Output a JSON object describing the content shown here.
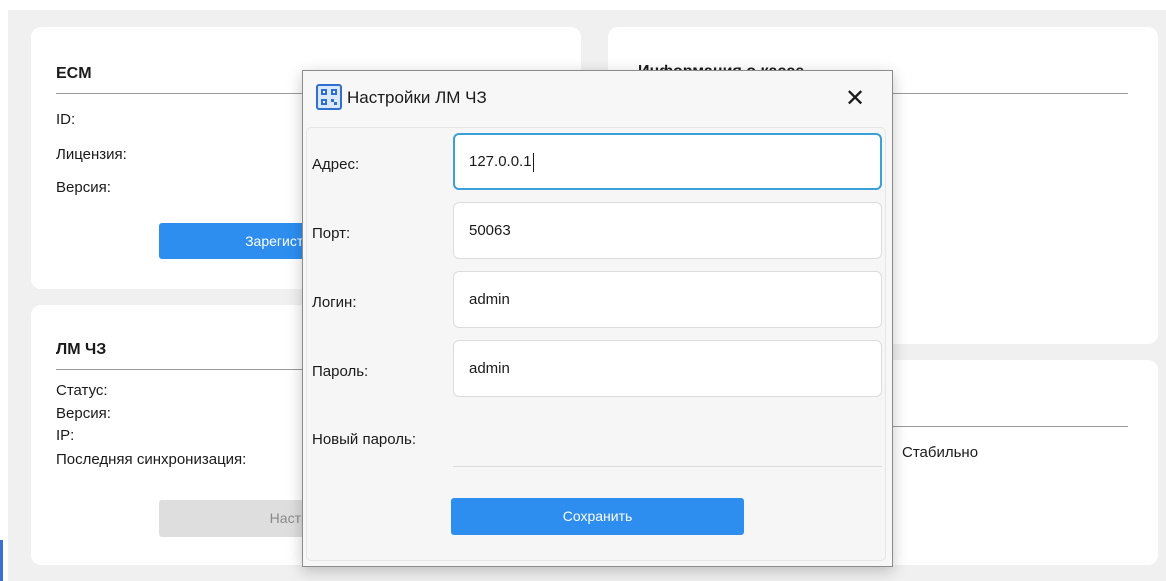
{
  "ecm_card": {
    "title": "ECM",
    "fields": [
      "ID:",
      "Лицензия:",
      "Версия:"
    ],
    "register_button": "Зарегистрировать"
  },
  "lm_card": {
    "title": "ЛМ ЧЗ",
    "fields": [
      "Статус:",
      "Версия:",
      "IP:",
      "Последняя синхронизация:"
    ],
    "settings_button": "Настройки"
  },
  "cash_info_card": {
    "title": "Информация о кассе"
  },
  "status_card": {
    "value": "Стабильно"
  },
  "dialog": {
    "title": "Настройки ЛМ ЧЗ",
    "address_label": "Адрес:",
    "address_value": "127.0.0.1",
    "port_label": "Порт:",
    "port_value": "50063",
    "login_label": "Логин:",
    "login_value": "admin",
    "password_label": "Пароль:",
    "password_value": "admin",
    "new_password_label": "Новый пароль:",
    "new_password_value": "",
    "save_button": "Сохранить"
  }
}
